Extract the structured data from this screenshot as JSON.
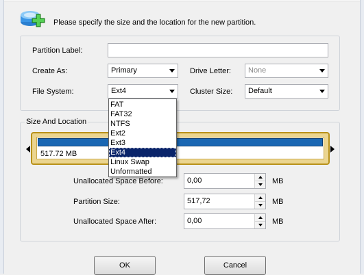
{
  "header": {
    "text": "Please specify the size and the location for the new partition."
  },
  "form": {
    "partition_label": {
      "label": "Partition Label:",
      "value": ""
    },
    "create_as": {
      "label": "Create As:",
      "value": "Primary"
    },
    "drive_letter": {
      "label": "Drive Letter:",
      "value": "None"
    },
    "file_system": {
      "label": "File System:",
      "value": "Ext4"
    },
    "cluster_size": {
      "label": "Cluster Size:",
      "value": "Default"
    }
  },
  "file_system_dropdown": {
    "options": [
      "FAT",
      "FAT32",
      "NTFS",
      "Ext2",
      "Ext3",
      "Ext4",
      "Linux Swap",
      "Unformatted"
    ],
    "selected": "Ext4"
  },
  "size_location": {
    "title": "Size And Location",
    "bar_text": "517.72 MB",
    "unallocated_before": {
      "label": "Unallocated Space Before:",
      "value": "0,00",
      "unit": "MB"
    },
    "partition_size": {
      "label": "Partition Size:",
      "value": "517,72",
      "unit": "MB"
    },
    "unallocated_after": {
      "label": "Unallocated Space After:",
      "value": "0,00",
      "unit": "MB"
    }
  },
  "buttons": {
    "ok": "OK",
    "cancel": "Cancel"
  },
  "icons": {
    "header": "disk-add-icon"
  },
  "colors": {
    "bar_fill": "#1a67b3",
    "bar_frame": "#ebd590",
    "selection": "#0a246a"
  }
}
